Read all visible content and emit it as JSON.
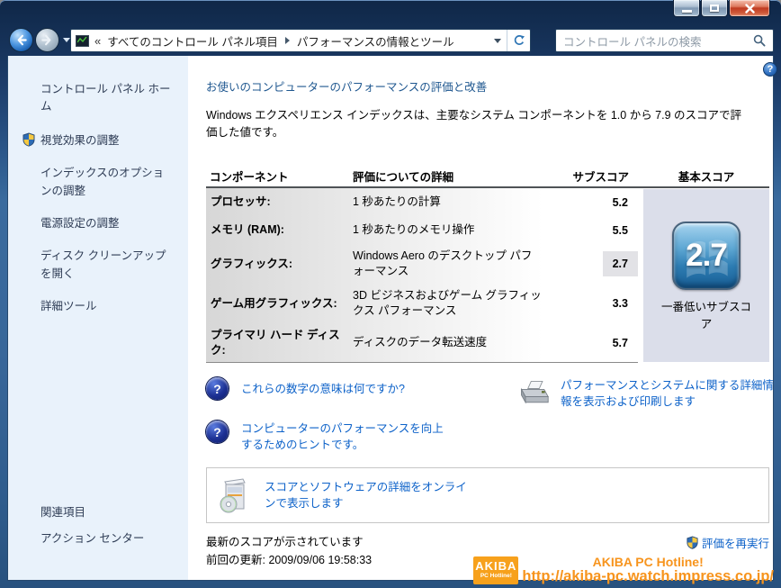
{
  "toolbar": {
    "breadcrumb": {
      "chevrons": "«",
      "root": "すべてのコントロール パネル項目",
      "current": "パフォーマンスの情報とツール"
    },
    "search_placeholder": "コントロール パネルの検索"
  },
  "sidebar": {
    "home": "コントロール パネル ホーム",
    "tasks": [
      {
        "label": "視覚効果の調整"
      },
      {
        "label": "インデックスのオプションの調整"
      },
      {
        "label": "電源設定の調整"
      },
      {
        "label": "ディスク クリーンアップを開く"
      },
      {
        "label": "詳細ツール"
      }
    ],
    "related_header": "関連項目",
    "related": [
      {
        "label": "アクション センター"
      }
    ]
  },
  "main": {
    "heading": "お使いのコンピューターのパフォーマンスの評価と改善",
    "intro": "Windows エクスペリエンス インデックスは、主要なシステム コンポーネントを 1.0 から 7.9 のスコアで評価した値です。",
    "table": {
      "col_component": "コンポーネント",
      "col_detail": "評価についての詳細",
      "col_subscore": "サブスコア",
      "col_base": "基本スコア",
      "rows": [
        {
          "component": "プロセッサ:",
          "detail": "1 秒あたりの計算",
          "subscore": "5.2"
        },
        {
          "component": "メモリ (RAM):",
          "detail": "1 秒あたりのメモリ操作",
          "subscore": "5.5"
        },
        {
          "component": "グラフィックス:",
          "detail": "Windows Aero のデスクトップ パフォーマンス",
          "subscore": "2.7"
        },
        {
          "component": "ゲーム用グラフィックス:",
          "detail": "3D ビジネスおよびゲーム グラフィックス パフォーマンス",
          "subscore": "3.3"
        },
        {
          "component": "プライマリ ハード ディスク:",
          "detail": "ディスクのデータ転送速度",
          "subscore": "5.7"
        }
      ],
      "base_score": "2.7",
      "base_caption": "一番低いサブスコア"
    },
    "links": {
      "what_numbers": "これらの数字の意味は何ですか?",
      "tips": "コンピューターのパフォーマンスを向上するためのヒントです。",
      "print_details": "パフォーマンスとシステムに関する詳細情報を表示および印刷します",
      "online_details": "スコアとソフトウェアの詳細をオンラインで表示します"
    },
    "status": {
      "latest": "最新のスコアが示されています",
      "updated": "前回の更新: 2009/09/06 19:58:33",
      "rerun": "評価を再実行"
    }
  },
  "watermark": {
    "logo_line1": "AKIBA",
    "logo_line2": "PC Hotline!",
    "name": "AKIBA PC Hotline!",
    "url": "http://akiba-pc.watch.impress.co.jp/"
  },
  "icons": {
    "question": "?"
  },
  "colors": {
    "accent_link_blue": "#0d62c9",
    "titlebar_blue": "#1c3c69",
    "sidebar_bg": "#e9f2fb",
    "base_panel": "#dbdeea",
    "watermark_orange": "#f7941d"
  }
}
